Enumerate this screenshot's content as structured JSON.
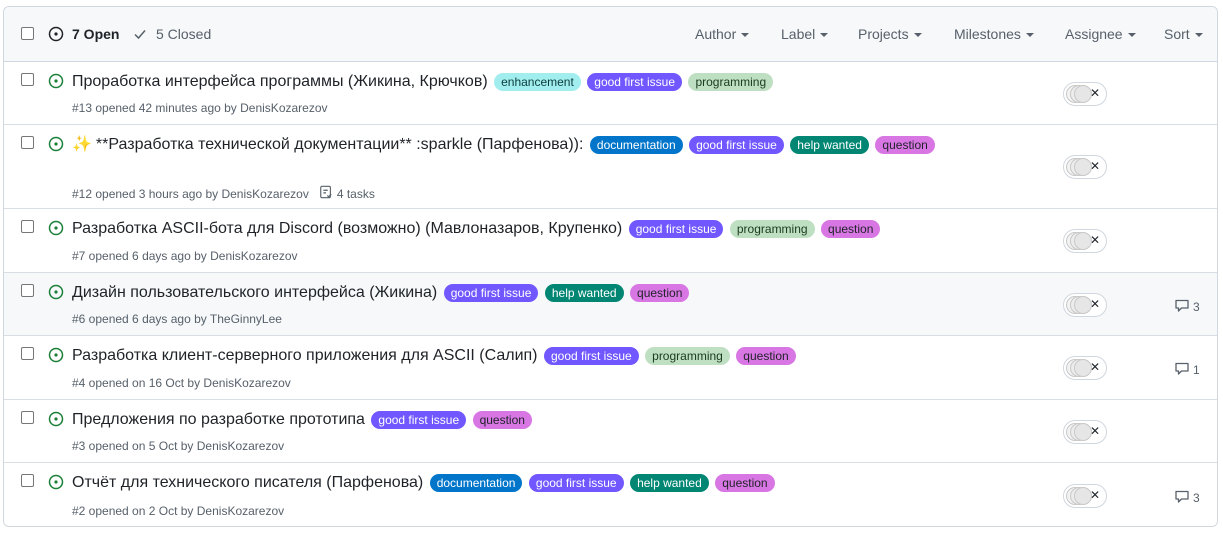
{
  "header": {
    "open_label": "7 Open",
    "closed_label": "5 Closed",
    "filters": [
      "Author",
      "Label",
      "Projects",
      "Milestones",
      "Assignee",
      "Sort"
    ]
  },
  "colors": {
    "enhancement": {
      "bg": "#a2eeef",
      "fg": "#0b3c3e"
    },
    "good first issue": {
      "bg": "#7057ff",
      "fg": "#ffffff"
    },
    "programming": {
      "bg": "#bfdfc2",
      "fg": "#1b3a1f"
    },
    "documentation": {
      "bg": "#0075ca",
      "fg": "#ffffff"
    },
    "help wanted": {
      "bg": "#008672",
      "fg": "#ffffff"
    },
    "question": {
      "bg": "#d876e3",
      "fg": "#1f2328"
    },
    "open_icon": "#1a7f37"
  },
  "issues": [
    {
      "title": "Проработка интерфейса программы (Жикина, Крючков)",
      "labels": [
        "enhancement",
        "good first issue",
        "programming"
      ],
      "meta": "#13 opened 42 minutes ago by DenisKozarezov",
      "comments": ""
    },
    {
      "title": "**Разработка технической документации** :sparkle (Парфенова)):",
      "emoji": "✨",
      "labels": [
        "documentation",
        "good first issue",
        "help wanted",
        "question"
      ],
      "meta": "#12 opened 3 hours ago by DenisKozarezov",
      "tasks": "4 tasks",
      "comments": ""
    },
    {
      "title": "Разработка ASCII-бота для Discord (возможно) (Мавлоназаров, Крупенко)",
      "labels": [
        "good first issue",
        "programming",
        "question"
      ],
      "meta": "#7 opened 6 days ago by DenisKozarezov",
      "comments": ""
    },
    {
      "title": "Дизайн пользовательского интерфейса (Жикина)",
      "labels": [
        "good first issue",
        "help wanted",
        "question"
      ],
      "meta": "#6 opened 6 days ago by TheGinnyLee",
      "comments": "3"
    },
    {
      "title": "Разработка клиент-серверного приложения для ASCII (Салип)",
      "labels": [
        "good first issue",
        "programming",
        "question"
      ],
      "meta": "#4 opened on 16 Oct by DenisKozarezov",
      "comments": "1"
    },
    {
      "title": "Предложения по разработке прототипа",
      "labels": [
        "good first issue",
        "question"
      ],
      "meta": "#3 opened on 5 Oct by DenisKozarezov",
      "comments": ""
    },
    {
      "title": "Отчёт для технического писателя (Парфенова)",
      "labels": [
        "documentation",
        "good first issue",
        "help wanted",
        "question"
      ],
      "meta": "#2 opened on 2 Oct by DenisKozarezov",
      "comments": "3"
    }
  ]
}
